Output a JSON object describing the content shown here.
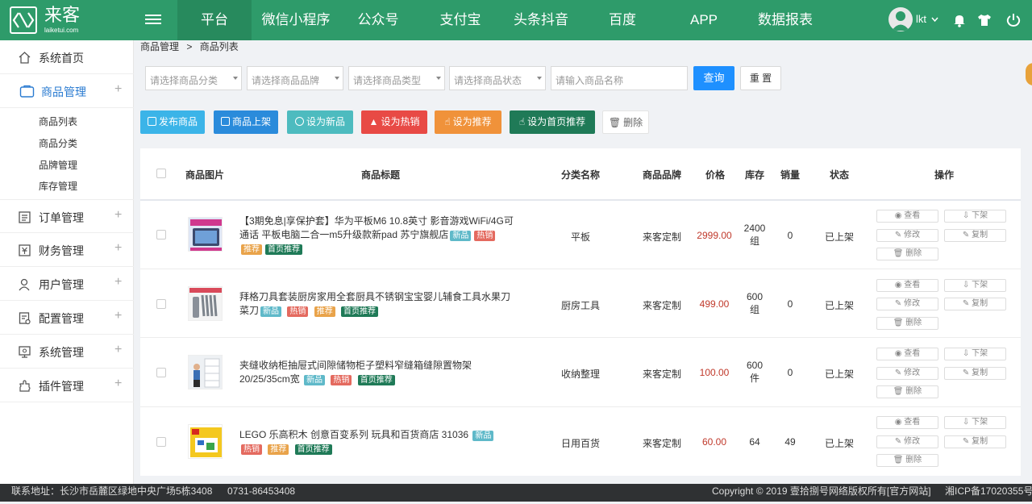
{
  "brand": {
    "name": "来客",
    "domain": "laiketui.com"
  },
  "top_nav": [
    {
      "label": "平台",
      "active": true
    },
    {
      "label": "微信小程序"
    },
    {
      "label": "公众号"
    },
    {
      "label": "支付宝"
    },
    {
      "label": "头条抖音"
    },
    {
      "label": "百度"
    },
    {
      "label": "APP"
    },
    {
      "label": "数据报表"
    }
  ],
  "user": {
    "name": "lkt"
  },
  "sidebar": {
    "items": [
      {
        "label": "系统首页",
        "icon": "home-icon"
      },
      {
        "label": "商品管理",
        "icon": "box-icon",
        "active": true
      },
      {
        "label": "订单管理",
        "icon": "order-icon"
      },
      {
        "label": "财务管理",
        "icon": "finance-icon"
      },
      {
        "label": "用户管理",
        "icon": "user-icon"
      },
      {
        "label": "配置管理",
        "icon": "config-icon"
      },
      {
        "label": "系统管理",
        "icon": "system-icon"
      },
      {
        "label": "插件管理",
        "icon": "plugin-icon"
      }
    ],
    "sub_items": [
      "商品列表",
      "商品分类",
      "品牌管理",
      "库存管理"
    ]
  },
  "breadcrumb": {
    "parent": "商品管理",
    "sep": ">",
    "current": "商品列表"
  },
  "filters": {
    "category": "请选择商品分类",
    "brand": "请选择商品品牌",
    "type": "请选择商品类型",
    "status": "请选择商品状态",
    "name": "请输入商品名称",
    "query": "查询",
    "reset": "重 置"
  },
  "actions": [
    {
      "label": "发布商品",
      "color": "#3bb4e8"
    },
    {
      "label": "商品上架",
      "color": "#2a8bdb"
    },
    {
      "label": "设为新品",
      "color": "#4dbbbf"
    },
    {
      "label": "设为热销",
      "color": "#e84a45"
    },
    {
      "label": "设为推荐",
      "color": "#f0923a"
    },
    {
      "label": "设为首页推荐",
      "color": "#1f7a57"
    },
    {
      "label": "删除",
      "color": "#ffffff"
    }
  ],
  "table": {
    "headers": [
      "商品图片",
      "商品标题",
      "分类名称",
      "商品品牌",
      "价格",
      "库存",
      "销量",
      "状态",
      "操作"
    ],
    "op_labels": {
      "view": "查看",
      "off": "下架",
      "edit": "修改",
      "copy": "复制",
      "delete": "删除"
    },
    "tags": {
      "new": "新品",
      "hot": "热销",
      "rec": "推荐",
      "home": "首页推荐"
    },
    "rows": [
      {
        "title": "【3期免息|享保护套】华为平板M6 10.8英寸 影音游戏WiFi/4G可通话 平板电脑二合一m5升级款新pad 苏宁旗舰店",
        "category": "平板",
        "brand": "来客定制",
        "price": "2999.00",
        "stock_num": "2400",
        "stock_unit": "组",
        "sales": "0",
        "status": "已上架"
      },
      {
        "title": "拜格刀具套装厨房家用全套厨具不锈钢宝宝婴儿辅食工具水果刀菜刀",
        "category": "厨房工具",
        "brand": "来客定制",
        "price": "499.00",
        "stock_num": "600",
        "stock_unit": "组",
        "sales": "0",
        "status": "已上架"
      },
      {
        "title": "夹缝收纳柜抽屉式间隙储物柜子塑料窄缝箱缝隙置物架20/25/35cm宽",
        "category": "收纳整理",
        "brand": "来客定制",
        "price": "100.00",
        "stock_num": "600",
        "stock_unit": "件",
        "sales": "0",
        "status": "已上架"
      },
      {
        "title": "LEGO 乐高积木 创意百变系列 玩具和百货商店 31036",
        "category": "日用百货",
        "brand": "来客定制",
        "price": "60.00",
        "stock_num": "64",
        "stock_unit": "",
        "sales": "49",
        "status": "已上架"
      }
    ]
  },
  "footer": {
    "address": "联系地址：长沙市岳麓区绿地中央广场5栋3408",
    "phone": "0731-86453408",
    "copyright": "Copyright © 2019 壹拾捌号网络版权所有[官方网站]",
    "icp": "湘ICP备17020355号"
  }
}
